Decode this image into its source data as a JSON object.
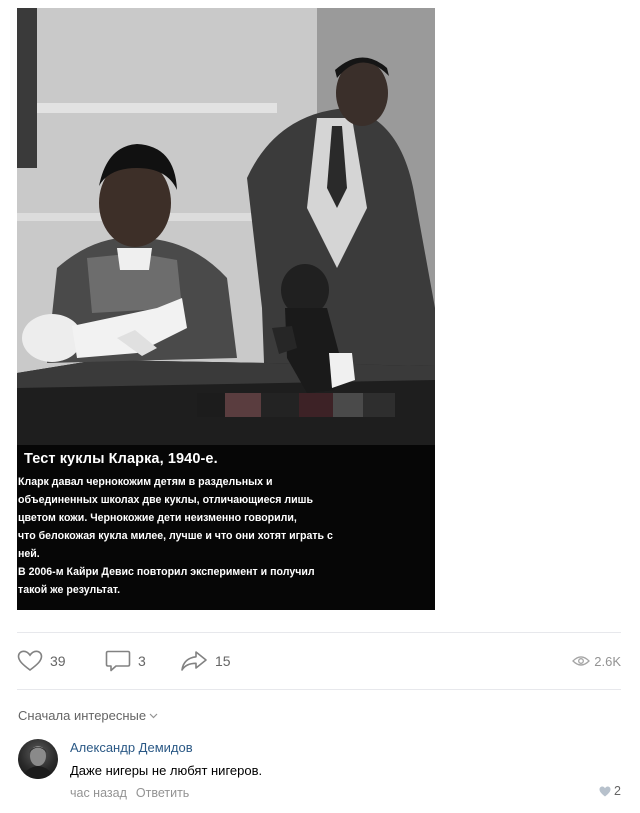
{
  "post": {
    "caption_title": "Тест куклы Кларка, 1940-е.",
    "caption_body": "Кларк давал чернокожим детям в раздельных и\nобъединенных школах две куклы, отличающиеся лишь\nцветом кожи. Чернокожие дети неизменно говорили,\nчто белокожая кукла милее, лучше и что они хотят играть с\nней.\nВ 2006-м Кайри Девис повторил эксперимент и получил\nтакой же результат."
  },
  "actions": {
    "likes": "39",
    "comments": "3",
    "shares": "15",
    "views": "2.6K",
    "like_icon": "heart-icon",
    "comment_icon": "speech-bubble-icon",
    "share_icon": "share-arrow-icon",
    "views_icon": "eye-icon"
  },
  "comments_section": {
    "sort_label": "Сначала интересные",
    "items": [
      {
        "author": "Александр Демидов",
        "text": "Даже нигеры не любят нигеров.",
        "time": "час назад",
        "reply_label": "Ответить",
        "likes": "2"
      }
    ]
  },
  "colors": {
    "link": "#2a5885",
    "muted": "#939393",
    "icon": "#656565",
    "divider": "#e7e8ec"
  }
}
